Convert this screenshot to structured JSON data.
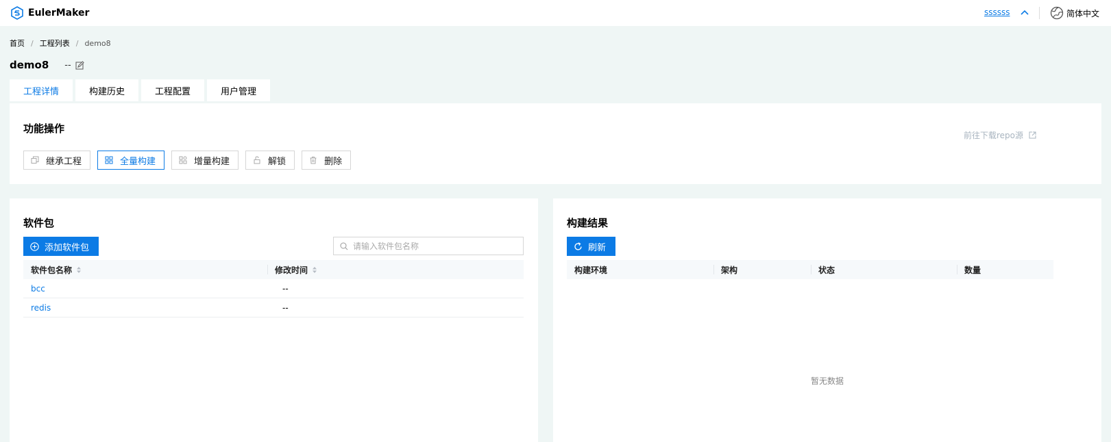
{
  "header": {
    "app_name": "EulerMaker",
    "user_name": "ssssss",
    "language": "简体中文"
  },
  "breadcrumb": {
    "home": "首页",
    "list": "工程列表",
    "current": "demo8",
    "separator": "/"
  },
  "project": {
    "title": "demo8",
    "description": "--"
  },
  "tabs": [
    {
      "label": "工程详情",
      "active": true
    },
    {
      "label": "构建历史",
      "active": false
    },
    {
      "label": "工程配置",
      "active": false
    },
    {
      "label": "用户管理",
      "active": false
    }
  ],
  "functions": {
    "title": "功能操作",
    "repo_link": "前往下载repo源",
    "buttons": {
      "inherit": "继承工程",
      "full_build": "全量构建",
      "incremental_build": "增量构建",
      "unlock": "解锁",
      "delete": "删除"
    }
  },
  "packages": {
    "title": "软件包",
    "add_button": "添加软件包",
    "search_placeholder": "请输入软件包名称",
    "columns": {
      "name": "软件包名称",
      "modified": "修改时间"
    },
    "rows": [
      {
        "name": "bcc",
        "modified": "--"
      },
      {
        "name": "redis",
        "modified": "--"
      }
    ]
  },
  "results": {
    "title": "构建结果",
    "refresh_button": "刷新",
    "columns": {
      "env": "构建环境",
      "arch": "架构",
      "status": "状态",
      "count": "数量"
    },
    "empty_text": "暂无数据"
  },
  "colors": {
    "accent": "#0c7be5",
    "page_bg": "#eff6f5"
  }
}
